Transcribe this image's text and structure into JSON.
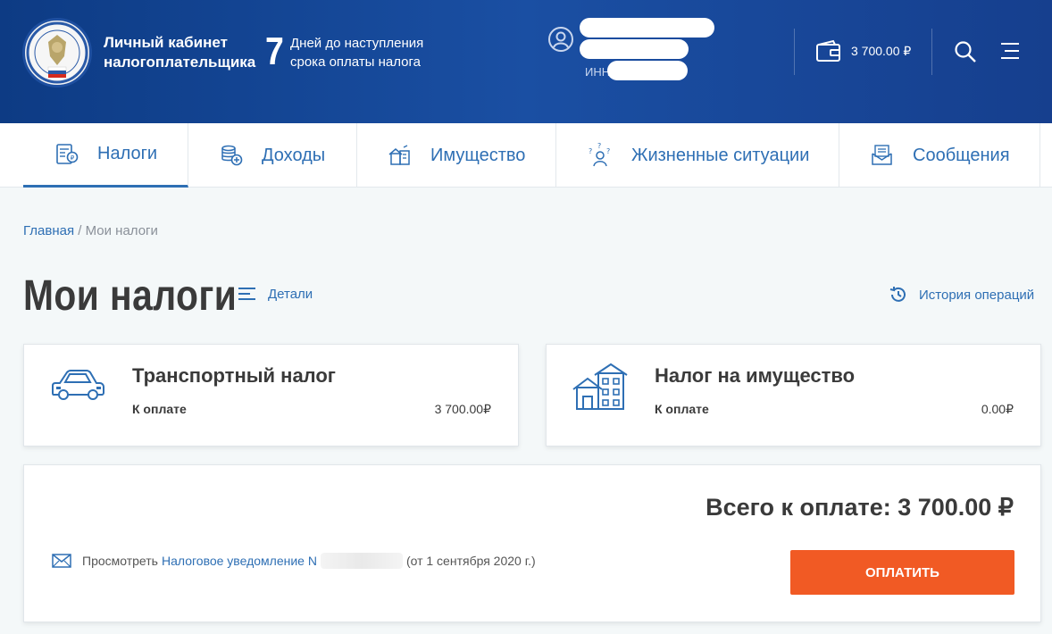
{
  "header": {
    "cabinet_line1": "Личный кабинет",
    "cabinet_line2": "налогоплательщика",
    "days_number": "7",
    "days_line1": "Дней до наступления",
    "days_line2": "срока оплаты налога",
    "inn_label": "ИНН",
    "wallet_amount": "3 700.00 ₽"
  },
  "tabs": [
    {
      "label": "Налоги",
      "icon": "taxes-icon",
      "active": true
    },
    {
      "label": "Доходы",
      "icon": "coins-icon",
      "active": false
    },
    {
      "label": "Имущество",
      "icon": "property-icon",
      "active": false
    },
    {
      "label": "Жизненные ситуации",
      "icon": "person-question-icon",
      "active": false
    },
    {
      "label": "Сообщения",
      "icon": "messages-icon",
      "active": false
    }
  ],
  "breadcrumb": {
    "home": "Главная",
    "separator": " / ",
    "current": "Мои налоги"
  },
  "page": {
    "title": "Мои налоги",
    "details_label": "Детали",
    "history_label": "История операций"
  },
  "cards": [
    {
      "title": "Транспортный налог",
      "label": "К оплате",
      "amount": "3 700.00₽",
      "icon": "car-icon"
    },
    {
      "title": "Налог на имущество",
      "label": "К оплате",
      "amount": "0.00₽",
      "icon": "house-icon"
    }
  ],
  "summary": {
    "total": "Всего к оплате: 3 700.00 ₽",
    "view_prefix": "Просмотреть",
    "notice_link": "Налоговое уведомление N",
    "notice_date": "(от 1 сентября 2020 г.)",
    "pay_button": "ОПЛАТИТЬ"
  },
  "colors": {
    "header_bg": "#1a4fa3",
    "accent": "#2e6fb4",
    "pay_button": "#f15a24"
  }
}
